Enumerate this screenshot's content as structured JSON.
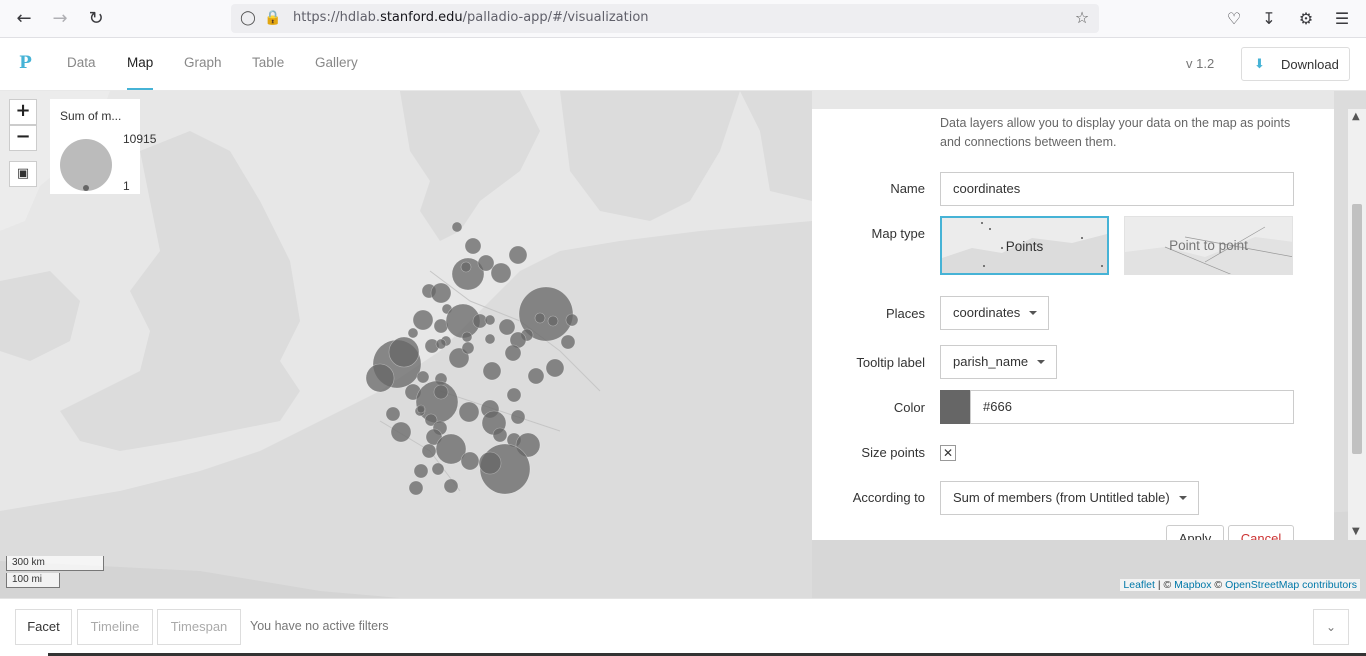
{
  "browser": {
    "url_prefix": "https://hdlab.",
    "url_domain": "stanford.edu",
    "url_path": "/palladio-app/#/visualization"
  },
  "header": {
    "logo": "P",
    "tabs": [
      "Data",
      "Map",
      "Graph",
      "Table",
      "Gallery"
    ],
    "active_tab": "Map",
    "version": "v 1.2",
    "download_label": "Download"
  },
  "map": {
    "zoom_in": "+",
    "zoom_out": "−",
    "legend": {
      "title": "Sum of m...",
      "max": "10915",
      "min": "1"
    },
    "scale_km": "300 km",
    "scale_mi": "100 mi",
    "attribution": {
      "leaflet": "Leaflet",
      "sep1": " | © ",
      "mapbox": "Mapbox",
      "sep2": " © ",
      "osm": "OpenStreetMap contributors"
    },
    "point_color": "#666666"
  },
  "panel": {
    "description": "Data layers allow you to display your data on the map as points and connections between them.",
    "name_label": "Name",
    "name_value": "coordinates",
    "map_type_label": "Map type",
    "map_type_options": [
      "Points",
      "Point to point"
    ],
    "map_type_selected": "Points",
    "places_label": "Places",
    "places_value": "coordinates",
    "tooltip_label": "Tooltip label",
    "tooltip_value": "parish_name",
    "color_label": "Color",
    "color_value": "#666",
    "size_label": "Size points",
    "size_checked": "✕",
    "according_label": "According to",
    "according_value": "Sum of members (from Untitled table)",
    "apply_label": "Apply",
    "cancel_label": "Cancel"
  },
  "footer": {
    "facet": "Facet",
    "timeline": "Timeline",
    "timespan": "Timespan",
    "message": "You have no active filters"
  }
}
